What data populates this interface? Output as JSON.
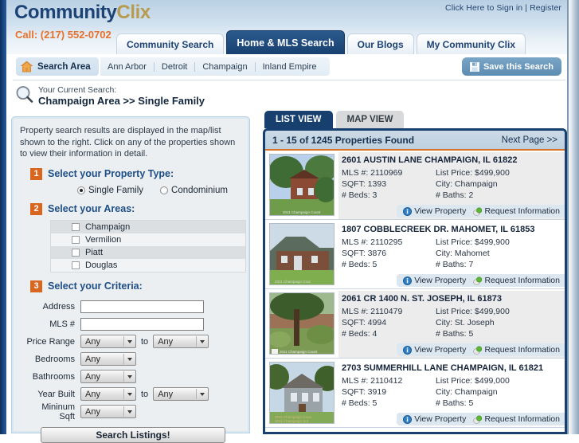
{
  "header": {
    "signin_text": "Click Here to Sign in | Register",
    "logo_part1": "Community",
    "logo_part2": "Clix",
    "phone": "Call: (217) 552-0702",
    "tabs": [
      {
        "label": "Community Search",
        "active": false
      },
      {
        "label": "Home & MLS Search",
        "active": true
      },
      {
        "label": "Our Blogs",
        "active": false
      },
      {
        "label": "My Community Clix",
        "active": false
      }
    ]
  },
  "area_bar": {
    "label": "Search Area",
    "links": [
      "Ann Arbor",
      "Detroit",
      "Champaign",
      "Inland Empire"
    ],
    "save_button": "Save this Search"
  },
  "current_search": {
    "caption": "Your Current Search:",
    "value": "Champaign Area >> Single Family"
  },
  "left_panel": {
    "blurb": "Property search results are displayed in the map/list shown to the right. Click on any of the properties shown to view their information in detail.",
    "step1": {
      "num": "1",
      "title": "Select your Property Type:",
      "options": [
        {
          "label": "Single Family",
          "selected": true
        },
        {
          "label": "Condominium",
          "selected": false
        }
      ]
    },
    "step2": {
      "num": "2",
      "title": "Select your Areas:",
      "areas": [
        {
          "label": "Champaign",
          "checked": false
        },
        {
          "label": "Vermilion",
          "checked": false
        },
        {
          "label": "Piatt",
          "checked": false
        },
        {
          "label": "Douglas",
          "checked": false
        }
      ]
    },
    "step3": {
      "num": "3",
      "title": "Select your Criteria:",
      "address_label": "Address",
      "address_value": "",
      "mls_label": "MLS #",
      "mls_value": "",
      "price_label": "Price Range",
      "price_from": "Any",
      "price_to": "Any",
      "beds_label": "Bedrooms",
      "beds_value": "Any",
      "baths_label": "Bathrooms",
      "baths_value": "Any",
      "year_label": "Year Built",
      "year_from": "Any",
      "year_to": "Any",
      "sqft_label": "Mininum Sqft",
      "sqft_value": "Any",
      "to_word": "to"
    },
    "search_button": "Search Listings!"
  },
  "right_panel": {
    "tabs": [
      {
        "label": "LIST VIEW",
        "active": true
      },
      {
        "label": "MAP VIEW",
        "active": false
      }
    ],
    "results_count": "1 - 15 of 1245 Properties Found",
    "next_page": "Next Page >>",
    "action_view": "View Property",
    "action_request": "Request Information",
    "watermark": "2011 Champaign Count",
    "listings": [
      {
        "address": "2601 AUSTIN LANE CHAMPAIGN, IL 61822",
        "mls": "MLS #: 2110969",
        "price": "List Price: $499,900",
        "sqft": "SQFT: 1393",
        "city": "City: Champaign",
        "beds": "# Beds: 3",
        "baths": "# Baths: 2"
      },
      {
        "address": "1807 COBBLECREEK DR. MAHOMET, IL 61853",
        "mls": "MLS #: 2110295",
        "price": "List Price: $499,900",
        "sqft": "SQFT: 3876",
        "city": "City: Mahomet",
        "beds": "# Beds: 5",
        "baths": "# Baths: 7"
      },
      {
        "address": "2061 CR 1400 N. ST. JOSEPH, IL 61873",
        "mls": "MLS #: 2110479",
        "price": "List Price: $499,900",
        "sqft": "SQFT: 4994",
        "city": "City: St. Joseph",
        "beds": "# Beds: 4",
        "baths": "# Baths: 5"
      },
      {
        "address": "2703 SUMMERHILL LANE CHAMPAIGN, IL 61821",
        "mls": "MLS #: 2110412",
        "price": "List Price: $499,000",
        "sqft": "SQFT: 3919",
        "city": "City: Champaign",
        "beds": "# Beds: 5",
        "baths": "# Baths: 5"
      }
    ]
  },
  "colors": {
    "navy": "#17406f",
    "orange": "#d9661f",
    "gold": "#b79b4e",
    "phone_orange": "#e8702a",
    "link_blue": "#1d4e87"
  }
}
